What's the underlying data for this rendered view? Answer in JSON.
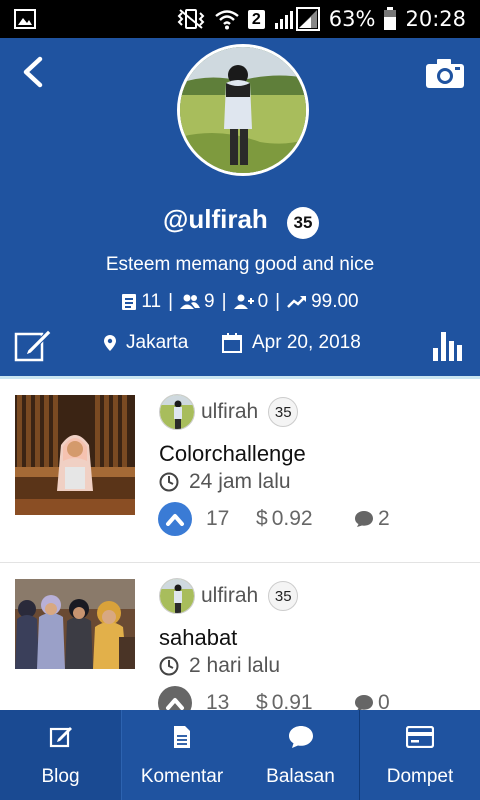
{
  "status_bar": {
    "sim_badge": "2",
    "battery": "63%",
    "time": "20:28"
  },
  "profile": {
    "username": "@ulfirah",
    "reputation": "35",
    "bio": "Esteem memang good and nice",
    "posts": "11",
    "followers": "9",
    "following": "0",
    "voting_power": "99.00",
    "location": "Jakarta",
    "joined": "Apr 20, 2018",
    "header_color": "#1f53a0"
  },
  "posts": [
    {
      "author": "ulfirah",
      "reputation": "35",
      "title": "Colorchallenge",
      "time": "24 jam lalu",
      "votes": "17",
      "payout": "0.92",
      "comments": "2",
      "voted": true
    },
    {
      "author": "ulfirah",
      "reputation": "35",
      "title": "sahabat",
      "time": "2 hari lalu",
      "votes": "13",
      "payout": "0.91",
      "comments": "0",
      "voted": false
    }
  ],
  "nav": {
    "blog": "Blog",
    "komentar": "Komentar",
    "balasan": "Balasan",
    "dompet": "Dompet"
  },
  "colors": {
    "accent": "#1f53a0",
    "vote_active": "#3a7bd5",
    "vote_inactive": "#666666"
  }
}
